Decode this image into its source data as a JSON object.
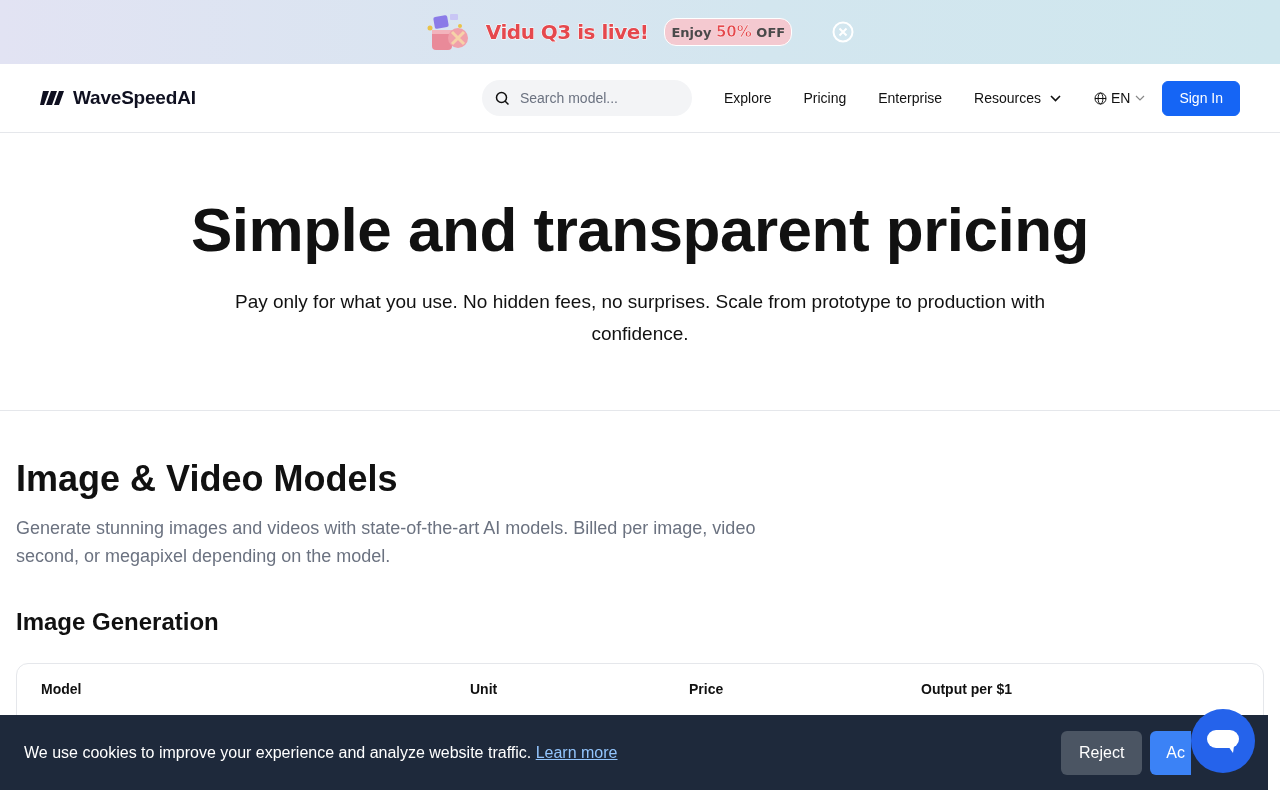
{
  "promo_banner": {
    "headline": "Vidu Q3 is live!",
    "offer": {
      "prefix": "Enjoy",
      "highlight": "50%",
      "suffix": "OFF"
    }
  },
  "navbar": {
    "brand": "WaveSpeedAI",
    "search": {
      "placeholder": "Search model..."
    },
    "links": [
      {
        "label": "Explore",
        "kind": "link"
      },
      {
        "label": "Pricing",
        "kind": "link"
      },
      {
        "label": "Enterprise",
        "kind": "link"
      },
      {
        "label": "Resources",
        "kind": "dropdown"
      }
    ],
    "language": "EN",
    "sign_in": "Sign In"
  },
  "hero": {
    "title": "Simple and transparent pricing",
    "subtitle": "Pay only for what you use. No hidden fees, no surprises. Scale from prototype to production with confidence."
  },
  "section": {
    "title": "Image & Video Models",
    "description": "Generate stunning images and videos with state-of-the-art AI models. Billed per image, video second, or megapixel depending on the model.",
    "subsection": "Image Generation",
    "table": {
      "columns": [
        "Model",
        "Unit",
        "Price",
        "Output per $1"
      ]
    }
  },
  "cookie_banner": {
    "message": "We use cookies to improve your experience and analyze website traffic.",
    "link": "Learn more",
    "reject": "Reject",
    "accept": "Ac"
  }
}
